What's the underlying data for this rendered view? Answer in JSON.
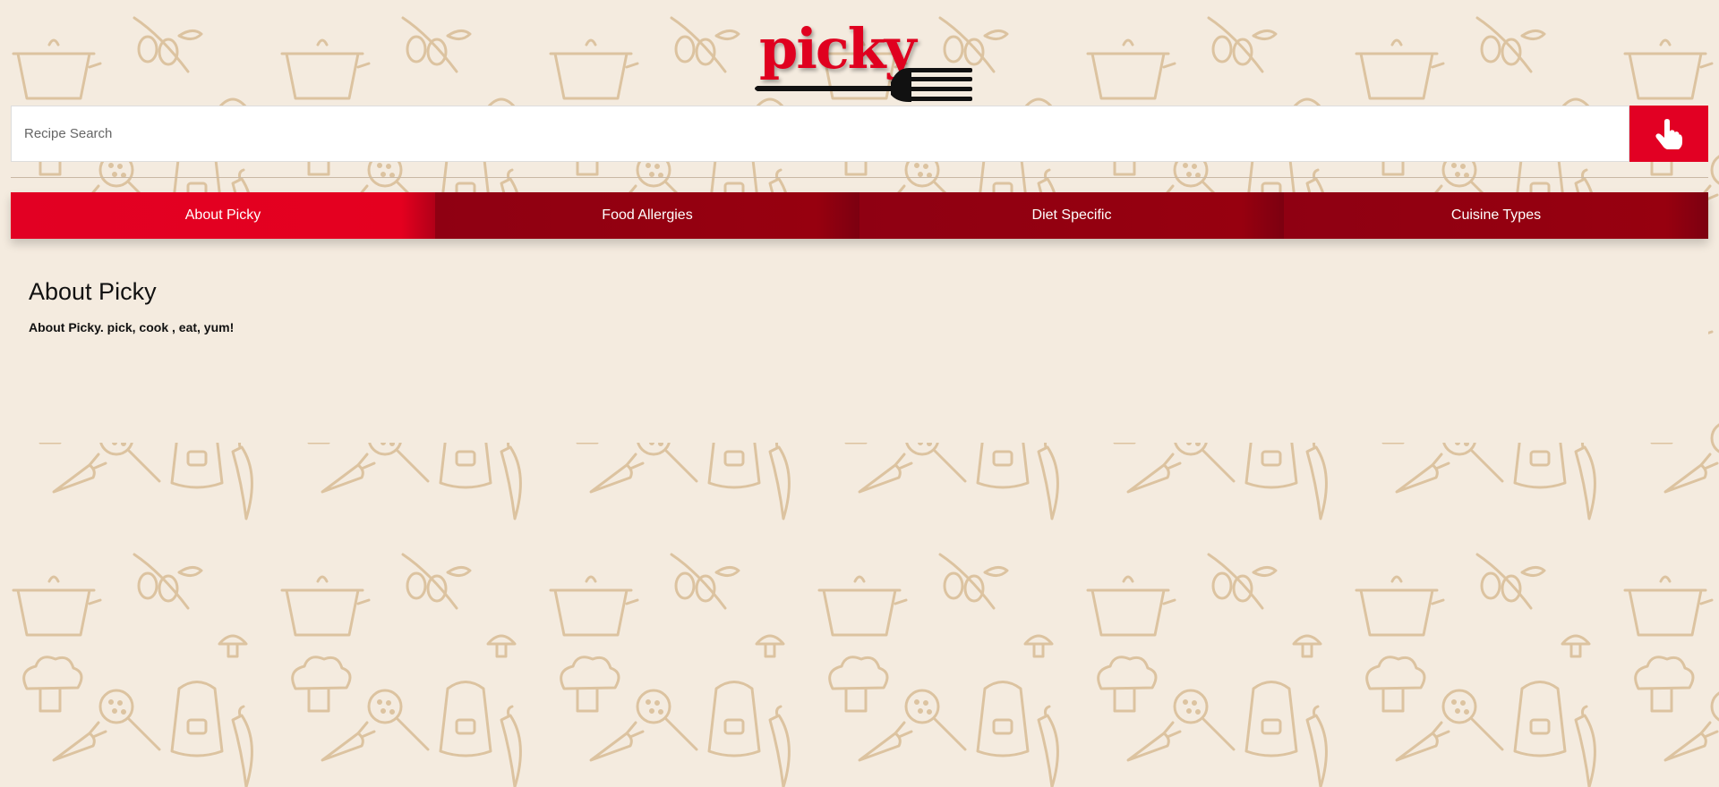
{
  "brand": {
    "logo_text": "picky",
    "colors": {
      "primary_red": "#e20023",
      "dark_red": "#8f0012",
      "background": "#f4ebdf",
      "pattern": "#dcc3a0"
    }
  },
  "search": {
    "placeholder": "Recipe Search",
    "button_icon": "hand-pointer-icon"
  },
  "tabs": [
    {
      "label": "About Picky",
      "active": true
    },
    {
      "label": "Food Allergies",
      "active": false
    },
    {
      "label": "Diet Specific",
      "active": false
    },
    {
      "label": "Cuisine Types",
      "active": false
    }
  ],
  "content": {
    "title": "About Picky",
    "body": "About Picky. pick, cook , eat, yum!"
  }
}
